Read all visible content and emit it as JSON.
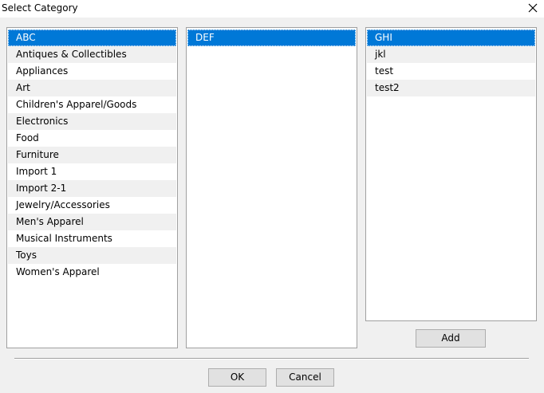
{
  "window": {
    "title": "Select Category",
    "close_icon": "close-icon"
  },
  "list1": {
    "items": [
      {
        "label": "ABC",
        "selected": true
      },
      {
        "label": "Antiques & Collectibles"
      },
      {
        "label": "Appliances"
      },
      {
        "label": "Art"
      },
      {
        "label": "Children's Apparel/Goods"
      },
      {
        "label": "Electronics"
      },
      {
        "label": "Food"
      },
      {
        "label": "Furniture"
      },
      {
        "label": "Import 1"
      },
      {
        "label": "Import 2-1"
      },
      {
        "label": "Jewelry/Accessories"
      },
      {
        "label": "Men's Apparel"
      },
      {
        "label": "Musical Instruments"
      },
      {
        "label": "Toys"
      },
      {
        "label": "Women's Apparel"
      }
    ]
  },
  "list2": {
    "items": [
      {
        "label": "DEF",
        "selected": true
      }
    ]
  },
  "list3": {
    "items": [
      {
        "label": "GHI",
        "selected": true
      },
      {
        "label": "jkl"
      },
      {
        "label": "test"
      },
      {
        "label": "test2"
      }
    ]
  },
  "buttons": {
    "add": "Add",
    "ok": "OK",
    "cancel": "Cancel"
  },
  "colors": {
    "selection": "#0078d7",
    "background": "#f0f0f0",
    "list_background": "#ffffff",
    "alt_row": "#f0f0f0"
  }
}
